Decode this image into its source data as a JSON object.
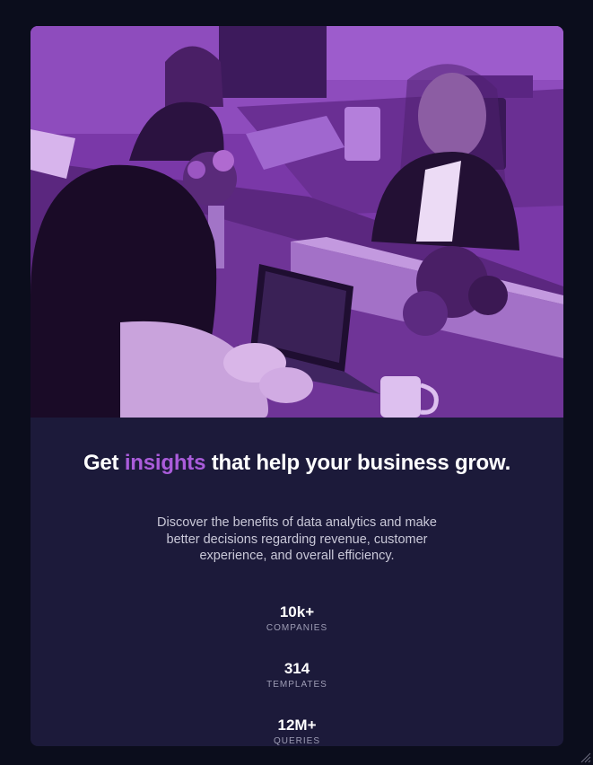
{
  "hero": {
    "image_alt": "Colleagues working at a shared table with laptops, purple duotone",
    "overlay_color": "#aa5cdb"
  },
  "headline": {
    "part1": "Get ",
    "accent": "insights",
    "part2": " that help your business grow.",
    "accent_color": "#aa5cdb"
  },
  "description": "Discover the benefits of data analytics and make better decisions regarding revenue, customer experience, and overall efficiency.",
  "stats": [
    {
      "value": "10k+",
      "label": "COMPANIES"
    },
    {
      "value": "314",
      "label": "TEMPLATES"
    },
    {
      "value": "12M+",
      "label": "QUERIES"
    }
  ],
  "colors": {
    "page_background": "#0b0d1c",
    "card_background": "#1c1a3a",
    "text_primary": "#ffffff",
    "text_secondary": "#c9c8d8"
  }
}
